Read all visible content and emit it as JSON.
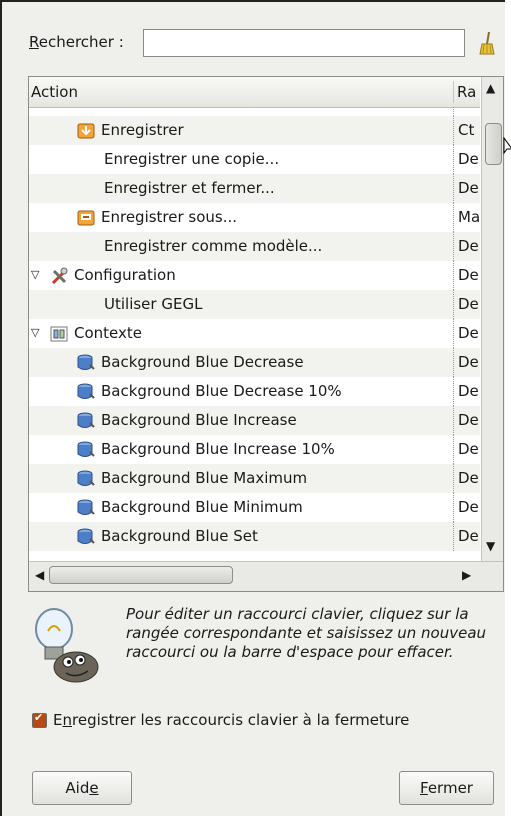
{
  "search": {
    "label": "Rechercher :",
    "mnemonic": "R",
    "value": "",
    "clear_icon": "broom-icon"
  },
  "tree": {
    "columns": {
      "action": "Action",
      "shortcut": "Ra"
    },
    "rows": [
      {
        "indent": 2,
        "icon": "",
        "label": "",
        "shortcut": "",
        "partial": true
      },
      {
        "indent": 2,
        "icon": "save-icon",
        "label": "Enregistrer",
        "shortcut": "Ct"
      },
      {
        "indent": 2,
        "icon": "",
        "label": "Enregistrer une copie...",
        "shortcut": "De"
      },
      {
        "indent": 2,
        "icon": "",
        "label": "Enregistrer et fermer...",
        "shortcut": "De"
      },
      {
        "indent": 2,
        "icon": "save-as-icon",
        "label": "Enregistrer sous...",
        "shortcut": "Ma"
      },
      {
        "indent": 2,
        "icon": "",
        "label": "Enregistrer comme modèle...",
        "shortcut": "De"
      },
      {
        "indent": 0,
        "expander": "▽",
        "icon": "tools-icon",
        "label": "Configuration",
        "shortcut": "De"
      },
      {
        "indent": 2,
        "icon": "",
        "label": "Utiliser GEGL",
        "shortcut": "De"
      },
      {
        "indent": 0,
        "expander": "▽",
        "icon": "context-icon",
        "label": "Contexte",
        "shortcut": "De"
      },
      {
        "indent": 1,
        "icon": "background-color-icon",
        "label": "Background Blue Decrease",
        "shortcut": "De"
      },
      {
        "indent": 1,
        "icon": "background-color-icon",
        "label": "Background Blue Decrease 10%",
        "shortcut": "De"
      },
      {
        "indent": 1,
        "icon": "background-color-icon",
        "label": "Background Blue Increase",
        "shortcut": "De"
      },
      {
        "indent": 1,
        "icon": "background-color-icon",
        "label": "Background Blue Increase 10%",
        "shortcut": "De"
      },
      {
        "indent": 1,
        "icon": "background-color-icon",
        "label": "Background Blue Maximum",
        "shortcut": "De"
      },
      {
        "indent": 1,
        "icon": "background-color-icon",
        "label": "Background Blue Minimum",
        "shortcut": "De"
      },
      {
        "indent": 1,
        "icon": "background-color-icon",
        "label": "Background Blue Set",
        "shortcut": "De"
      }
    ]
  },
  "info": {
    "icon": "wilber-lightbulb-icon",
    "text": "Pour éditer un raccourci clavier, cliquez sur la rangée correspondante et saisissez un nouveau raccourci ou la barre d'espace pour effacer."
  },
  "save_on_exit": {
    "label": "Enregistrer les raccourcis clavier à la fermeture",
    "checked": true
  },
  "buttons": {
    "help": "Aide",
    "close": "Fermer"
  },
  "colors": {
    "accent": "#b74a14",
    "dialog_bg": "#efefec"
  }
}
